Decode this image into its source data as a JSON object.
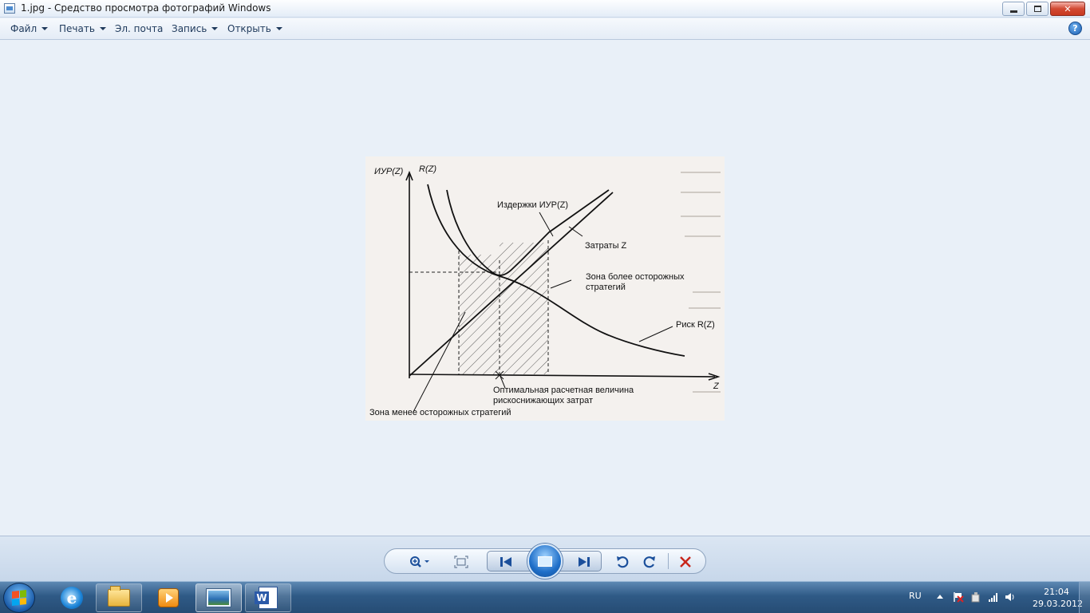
{
  "window": {
    "title": "1.jpg - Средство просмотра фотографий Windows"
  },
  "menu": {
    "file": "Файл",
    "print": "Печать",
    "email": "Эл. почта",
    "burn": "Запись",
    "open": "Открыть",
    "help_glyph": "?"
  },
  "photo": {
    "y_axis_label_1": "ИУР(Z)",
    "y_axis_label_2": "R(Z)",
    "costs_label": "Издержки ИУР(Z)",
    "expenses_label": "Затраты Z",
    "cautious_zone_line1": "Зона более осторожных",
    "cautious_zone_line2": "стратегий",
    "risk_label": "Риск R(Z)",
    "x_axis_label": "Z",
    "optimal_line1": "Оптимальная расчетная величина",
    "optimal_line2": "рискоснижающих затрат",
    "less_cautious_zone": "Зона менее осторожных стратегий"
  },
  "controls": {
    "zoom": "zoom-icon",
    "fit": "fit-window-icon",
    "previous": "previous-icon",
    "slideshow": "slideshow-icon",
    "next": "next-icon",
    "rotate_ccw": "rotate-counterclockwise-icon",
    "rotate_cw": "rotate-clockwise-icon",
    "delete": "delete-icon"
  },
  "taskbar": {
    "language": "RU",
    "time": "21:04",
    "date": "29.03.2012"
  },
  "colors": {
    "accent": "#1b4f9b",
    "delete": "#c8261b",
    "viewer_bg": "#e9f0f8"
  }
}
